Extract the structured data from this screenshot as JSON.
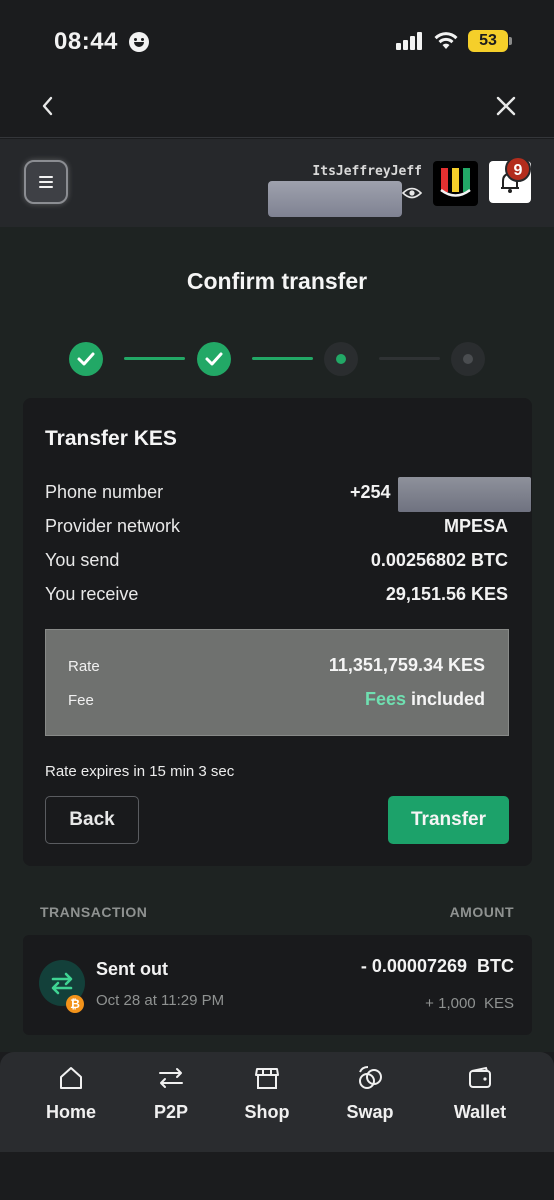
{
  "status_bar": {
    "time": "08:44",
    "battery": "53"
  },
  "header": {
    "username": "ItsJeffreyJeff",
    "notification_count": "9"
  },
  "page": {
    "title": "Confirm transfer"
  },
  "stepper": {
    "completed": 2,
    "current": 3,
    "total": 4
  },
  "transfer_card": {
    "title": "Transfer KES",
    "rows": [
      {
        "label": "Phone number",
        "value": "+254"
      },
      {
        "label": "Provider network",
        "value": "MPESA"
      },
      {
        "label": "You send",
        "value": "0.00256802 BTC"
      },
      {
        "label": "You receive",
        "value": "29,151.56 KES"
      }
    ],
    "rate_label": "Rate",
    "rate_value": "11,351,759.34 KES",
    "fee_label": "Fee",
    "fee_highlight": "Fees",
    "fee_rest": " included",
    "expires": "Rate expires in 15 min 3 sec",
    "back_label": "Back",
    "transfer_label": "Transfer"
  },
  "transactions": {
    "header_left": "TRANSACTION",
    "header_right": "AMOUNT",
    "items": [
      {
        "title": "Sent out",
        "date": "Oct 28 at 11:29 PM",
        "amount": "- 0.00007269  BTC",
        "sub": "+ 1,000  KES",
        "badge": "₿"
      }
    ]
  },
  "bottom_nav": [
    {
      "label": "Home",
      "icon": "home-icon"
    },
    {
      "label": "P2P",
      "icon": "p2p-icon"
    },
    {
      "label": "Shop",
      "icon": "shop-icon"
    },
    {
      "label": "Swap",
      "icon": "swap-icon"
    },
    {
      "label": "Wallet",
      "icon": "wallet-icon"
    }
  ],
  "colors": {
    "accent": "#1ca26a",
    "fee_highlight": "#6fe0b1",
    "badge": "#b32d1d",
    "battery": "#f5cf2a"
  }
}
